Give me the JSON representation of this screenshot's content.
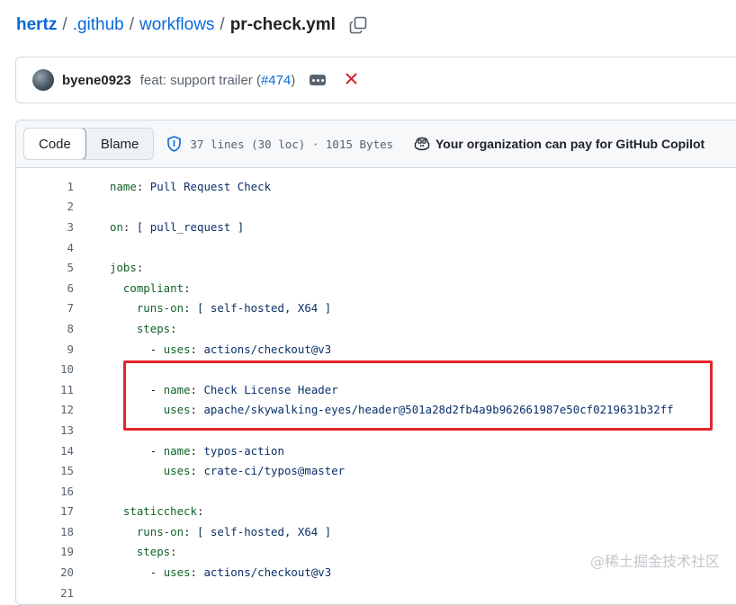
{
  "breadcrumb": {
    "repo": "hertz",
    "folder1": ".github",
    "folder2": "workflows",
    "file": "pr-check.yml",
    "separator": "/"
  },
  "commit": {
    "author": "byene0923",
    "message": "feat: support trailer (",
    "pr": "#474",
    "message_end": ")",
    "status": "failed"
  },
  "file_header": {
    "tab_code": "Code",
    "tab_blame": "Blame",
    "info": "37 lines (30 loc) · 1015 Bytes",
    "copilot_notice": "Your organization can pay for GitHub Copilot"
  },
  "code_lines": [
    {
      "n": "1",
      "indent": "",
      "key": "name",
      "value": " Pull Request Check"
    },
    {
      "n": "2",
      "indent": "",
      "key": "",
      "value": ""
    },
    {
      "n": "3",
      "indent": "",
      "key": "on",
      "value": " [ pull_request ]"
    },
    {
      "n": "4",
      "indent": "",
      "key": "",
      "value": ""
    },
    {
      "n": "5",
      "indent": "",
      "key": "jobs",
      "value": ""
    },
    {
      "n": "6",
      "indent": "  ",
      "key": "compliant",
      "value": ""
    },
    {
      "n": "7",
      "indent": "    ",
      "key": "runs-on",
      "value": " [ self-hosted, X64 ]"
    },
    {
      "n": "8",
      "indent": "    ",
      "key": "steps",
      "value": ""
    },
    {
      "n": "9",
      "indent": "      - ",
      "key": "uses",
      "value": " actions/checkout@v3"
    },
    {
      "n": "10",
      "indent": "",
      "key": "",
      "value": ""
    },
    {
      "n": "11",
      "indent": "      - ",
      "key": "name",
      "value": " Check License Header"
    },
    {
      "n": "12",
      "indent": "        ",
      "key": "uses",
      "value": " apache/skywalking-eyes/header@501a28d2fb4a9b962661987e50cf0219631b32ff"
    },
    {
      "n": "13",
      "indent": "",
      "key": "",
      "value": ""
    },
    {
      "n": "14",
      "indent": "      - ",
      "key": "name",
      "value": " typos-action"
    },
    {
      "n": "15",
      "indent": "        ",
      "key": "uses",
      "value": " crate-ci/typos@master"
    },
    {
      "n": "16",
      "indent": "",
      "key": "",
      "value": ""
    },
    {
      "n": "17",
      "indent": "  ",
      "key": "staticcheck",
      "value": ""
    },
    {
      "n": "18",
      "indent": "    ",
      "key": "runs-on",
      "value": " [ self-hosted, X64 ]"
    },
    {
      "n": "19",
      "indent": "    ",
      "key": "steps",
      "value": ""
    },
    {
      "n": "20",
      "indent": "      - ",
      "key": "uses",
      "value": " actions/checkout@v3"
    },
    {
      "n": "21",
      "indent": "",
      "key": "",
      "value": ""
    }
  ],
  "watermark": "@稀土掘金技术社区",
  "colors": {
    "link": "#0969da",
    "yaml_key": "#116329",
    "yaml_value": "#0a3069",
    "highlight_border": "#e3242b",
    "fail": "#d1242f"
  },
  "icons": {
    "copy": "copy-icon",
    "more": "kebab-horizontal-icon",
    "status": "x-icon",
    "shield": "shield-check-icon",
    "copilot": "copilot-icon"
  }
}
